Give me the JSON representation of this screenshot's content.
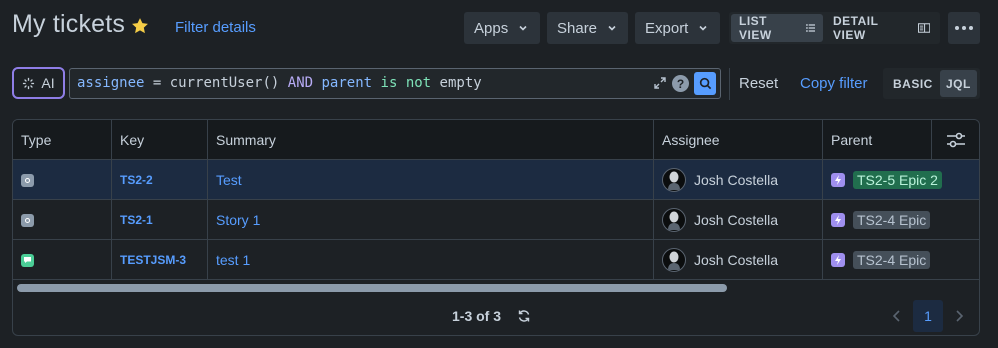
{
  "header": {
    "title": "My tickets",
    "filter_details": "Filter details",
    "apps": "Apps",
    "share": "Share",
    "export": "Export",
    "list_view": "LIST VIEW",
    "detail_view": "DETAIL VIEW"
  },
  "query": {
    "ai_label": "AI",
    "tokens": [
      "assignee",
      "=",
      "currentUser()",
      "AND",
      "parent",
      "is",
      "not",
      "empty"
    ],
    "reset": "Reset",
    "copy_filter": "Copy filter",
    "basic": "BASIC",
    "jql": "JQL",
    "help": "?"
  },
  "table": {
    "columns": [
      "Type",
      "Key",
      "Summary",
      "Assignee",
      "Parent"
    ],
    "rows": [
      {
        "type_icon": "subtask-icon",
        "key": "TS2-2",
        "summary": "Test",
        "assignee": "Josh Costella",
        "parent": "TS2-5 Epic 2"
      },
      {
        "type_icon": "subtask-icon",
        "key": "TS2-1",
        "summary": "Story 1",
        "assignee": "Josh Costella",
        "parent": "TS2-4 Epic"
      },
      {
        "type_icon": "message-icon",
        "key": "TESTJSM-3",
        "summary": "test 1",
        "assignee": "Josh Costella",
        "parent": "TS2-4 Epic"
      }
    ],
    "count": "1-3 of 3",
    "page": "1"
  },
  "colors": {
    "accent": "#579dff",
    "star": "#f5cd47",
    "epic": "#9f8fef",
    "service_request": "#4bce97"
  }
}
